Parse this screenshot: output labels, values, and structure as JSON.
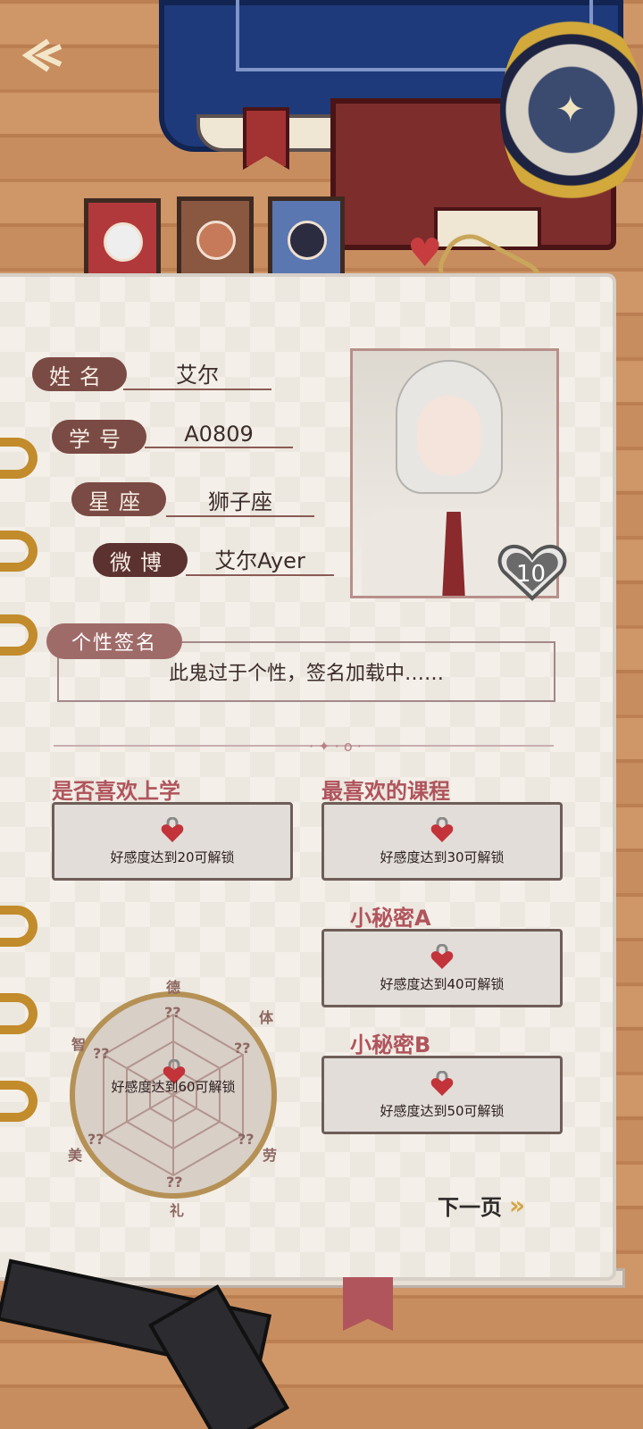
{
  "fields": {
    "name_label": "姓名",
    "name_value": "艾尔",
    "id_label": "学号",
    "id_value": "A0809",
    "zodiac_label": "星座",
    "zodiac_value": "狮子座",
    "weibo_label": "微博",
    "weibo_value": "艾尔Ayer"
  },
  "affection_level": "10",
  "signature": {
    "label": "个性签名",
    "text": "此鬼过于个性，签名加载中……"
  },
  "locked": [
    {
      "title": "是否喜欢上学",
      "text": "好感度达到20可解锁"
    },
    {
      "title": "最喜欢的课程",
      "text": "好感度达到30可解锁"
    },
    {
      "title": "小秘密A",
      "text": "好感度达到40可解锁"
    },
    {
      "title": "小秘密B",
      "text": "好感度达到50可解锁"
    }
  ],
  "radar": {
    "labels": [
      "德",
      "体",
      "劳",
      "礼",
      "美",
      "智"
    ],
    "values": [
      "??",
      "??",
      "??",
      "??",
      "??",
      "??"
    ],
    "lock_text": "好感度达到60可解锁"
  },
  "next_page": "下一页",
  "colors": {
    "accent": "#b0545c",
    "tab_red": "#b2393b",
    "tab_brown": "#8a5741",
    "tab_blue": "#5a77b2"
  }
}
